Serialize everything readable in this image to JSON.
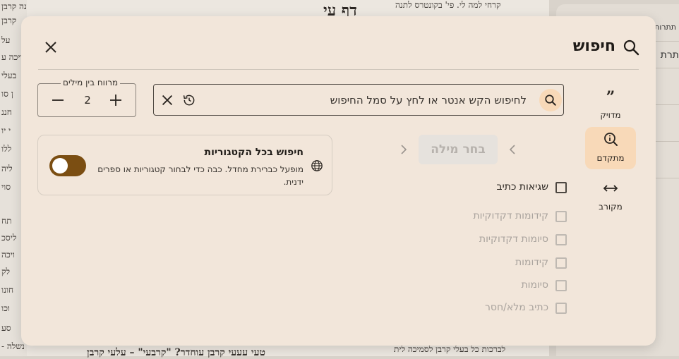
{
  "background": {
    "title": "דף עי",
    "top_line": "קרחי למה לי. פי' בקונטרס לתנה",
    "bottom_line": "לברכות כל בעלי קרבן לסמיכה לית",
    "bottom_left_line": "טעי עעעי קרבן עוחדר? \"קרבעי\" – עלעי קרבן",
    "left_margin_lines": [
      "ונה קרבן",
      "קרבן",
      "על",
      "ויכה ע",
      "בעלי",
      "ן סו",
      "חננ",
      "י יו",
      "ללו",
      "ליה",
      "סוי",
      "תח",
      "ליסכ",
      "ויכה",
      "לק",
      "חונו",
      "וכו",
      "סע",
      "נשלה -"
    ],
    "right_panel": {
      "tab_label": "תתרות",
      "row_text": "תרת"
    }
  },
  "modal": {
    "title": "חיפוש",
    "title_icon": "search-icon",
    "close_icon": "close-icon"
  },
  "nav": {
    "items": [
      {
        "id": "exact",
        "label": "מדויק",
        "icon": "quote-icon",
        "active": false
      },
      {
        "id": "advanced",
        "label": "מתקדם",
        "icon": "info-search-icon",
        "active": true
      },
      {
        "id": "approx",
        "label": "מקורב",
        "icon": "arrows-horizontal-icon",
        "active": false
      }
    ]
  },
  "search": {
    "placeholder": "לחיפוש הקש אנטר או לחץ על סמל החיפוש",
    "value": ""
  },
  "word_gap": {
    "label": "מרווח בין מילים",
    "value": "2"
  },
  "word_chooser": {
    "label": "בחר מילה"
  },
  "all_categories": {
    "title": "חיפוש בכל הקטגוריות",
    "description": "מופעל כברירת מחדל. כבה כדי לבחור קטגוריות או ספרים ידנית.",
    "enabled": true
  },
  "options": [
    {
      "label": "שגיאות כתיב",
      "enabled": true,
      "checked": false
    },
    {
      "label": "קידומות דקדוקיות",
      "enabled": false,
      "checked": false
    },
    {
      "label": "סיומות דקדוקיות",
      "enabled": false,
      "checked": false
    },
    {
      "label": "קידומות",
      "enabled": false,
      "checked": false
    },
    {
      "label": "סיומות",
      "enabled": false,
      "checked": false
    },
    {
      "label": "כתיב מלא/חסר",
      "enabled": false,
      "checked": false
    }
  ],
  "colors": {
    "modal_bg": "#f2e6da",
    "accent": "#f8d9b8",
    "toggle_on": "#7b4e12"
  }
}
